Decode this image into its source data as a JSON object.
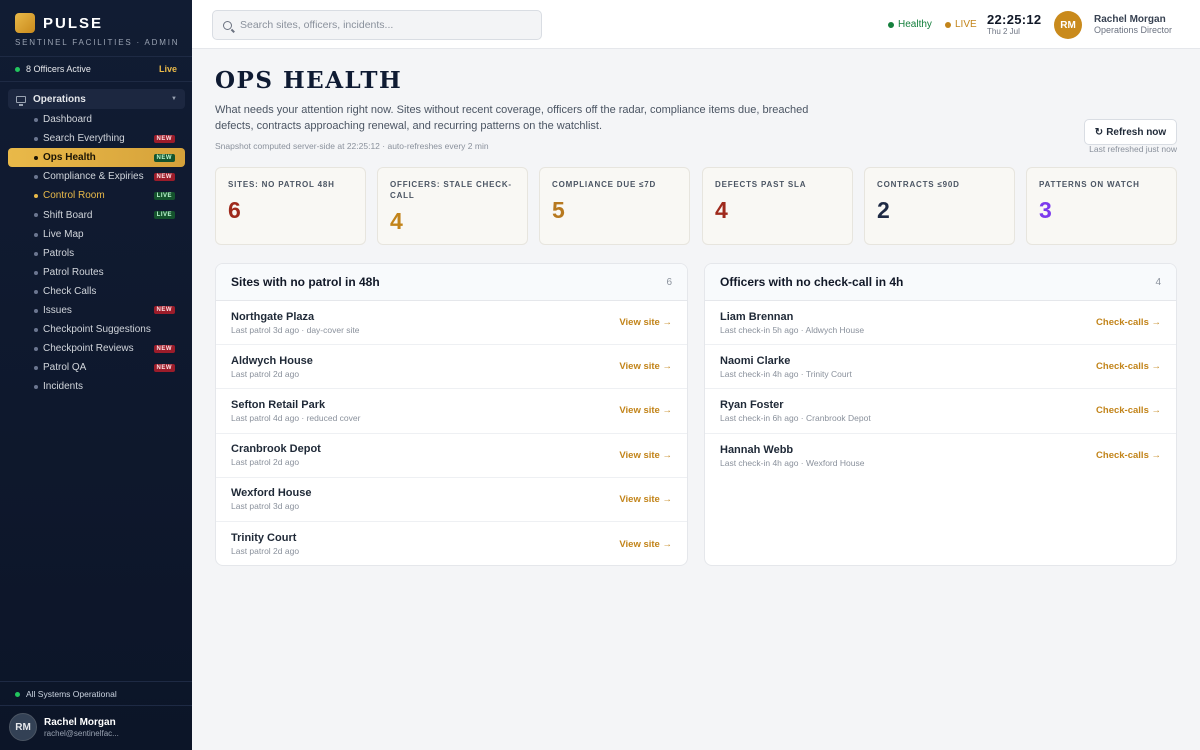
{
  "brand": {
    "name": "PULSE",
    "subtitle": "SENTINEL FACILITIES · ADMIN"
  },
  "sidebar": {
    "officers_active": "8 Officers Active",
    "live_label": "Live",
    "group_label": "Operations",
    "items": [
      {
        "label": "Dashboard",
        "badge": ""
      },
      {
        "label": "Search Everything",
        "badge": "NEW"
      },
      {
        "label": "Ops Health",
        "badge": "NEW"
      },
      {
        "label": "Compliance & Expiries",
        "badge": "NEW"
      },
      {
        "label": "Control Room",
        "badge": "LIVE"
      },
      {
        "label": "Shift Board",
        "badge": "LIVE"
      },
      {
        "label": "Live Map",
        "badge": ""
      },
      {
        "label": "Patrols",
        "badge": ""
      },
      {
        "label": "Patrol Routes",
        "badge": ""
      },
      {
        "label": "Check Calls",
        "badge": ""
      },
      {
        "label": "Issues",
        "badge": "NEW"
      },
      {
        "label": "Checkpoint Suggestions",
        "badge": ""
      },
      {
        "label": "Checkpoint Reviews",
        "badge": "NEW"
      },
      {
        "label": "Patrol QA",
        "badge": "NEW"
      },
      {
        "label": "Incidents",
        "badge": ""
      }
    ],
    "active_item": "Ops Health",
    "system_status": "All Systems Operational",
    "user": {
      "initials": "RM",
      "name": "Rachel Morgan",
      "email": "rachel@sentinelfac..."
    }
  },
  "topbar": {
    "search_placeholder": "Search sites, officers, incidents...",
    "status_healthy": "Healthy",
    "status_live": "LIVE",
    "time": "22:25:12",
    "date": "Thu 2 Jul",
    "user": {
      "initials": "RM",
      "name": "Rachel Morgan",
      "role": "Operations Director"
    }
  },
  "main": {
    "title": "OPS HEALTH",
    "description": "What needs your attention right now. Sites without recent coverage, officers off the radar, compliance items due, breached defects, contracts approaching renewal, and recurring patterns on the watchlist.",
    "snapshot": "Snapshot computed server-side at 22:25:12 · auto-refreshes every 2 min",
    "refresh_label": "Refresh now",
    "last_refreshed": "Last refreshed just now",
    "stats": [
      {
        "label": "SITES: NO PATROL 48H",
        "value": "6",
        "color": "#9f2a1c"
      },
      {
        "label": "OFFICERS: STALE CHECK-CALL",
        "value": "4",
        "color": "#c2841a"
      },
      {
        "label": "COMPLIANCE DUE ≤7D",
        "value": "5",
        "color": "#b7791f"
      },
      {
        "label": "DEFECTS PAST SLA",
        "value": "4",
        "color": "#9f2a1c"
      },
      {
        "label": "CONTRACTS ≤90D",
        "value": "2",
        "color": "#1e2a44"
      },
      {
        "label": "PATTERNS ON WATCH",
        "value": "3",
        "color": "#7c3aed"
      }
    ],
    "sites_panel": {
      "title": "Sites with no patrol in 48h",
      "count": "6",
      "rows": [
        {
          "name": "Northgate Plaza",
          "sub": "Last patrol 3d ago · day-cover site",
          "action": "View site →"
        },
        {
          "name": "Aldwych House",
          "sub": "Last patrol 2d ago",
          "action": "View site →"
        },
        {
          "name": "Sefton Retail Park",
          "sub": "Last patrol 4d ago · reduced cover",
          "action": "View site →"
        },
        {
          "name": "Cranbrook Depot",
          "sub": "Last patrol 2d ago",
          "action": "View site →"
        },
        {
          "name": "Wexford House",
          "sub": "Last patrol 3d ago",
          "action": "View site →"
        },
        {
          "name": "Trinity Court",
          "sub": "Last patrol 2d ago",
          "action": "View site →"
        }
      ]
    },
    "officers_panel": {
      "title": "Officers with no check-call in 4h",
      "count": "4",
      "rows": [
        {
          "name": "Liam Brennan",
          "sub": "Last check-in 5h ago · Aldwych House",
          "action": "Check-calls →"
        },
        {
          "name": "Naomi Clarke",
          "sub": "Last check-in 4h ago · Trinity Court",
          "action": "Check-calls →"
        },
        {
          "name": "Ryan Foster",
          "sub": "Last check-in 6h ago · Cranbrook Depot",
          "action": "Check-calls →"
        },
        {
          "name": "Hannah Webb",
          "sub": "Last check-in 4h ago · Wexford House",
          "action": "Check-calls →"
        }
      ]
    }
  }
}
